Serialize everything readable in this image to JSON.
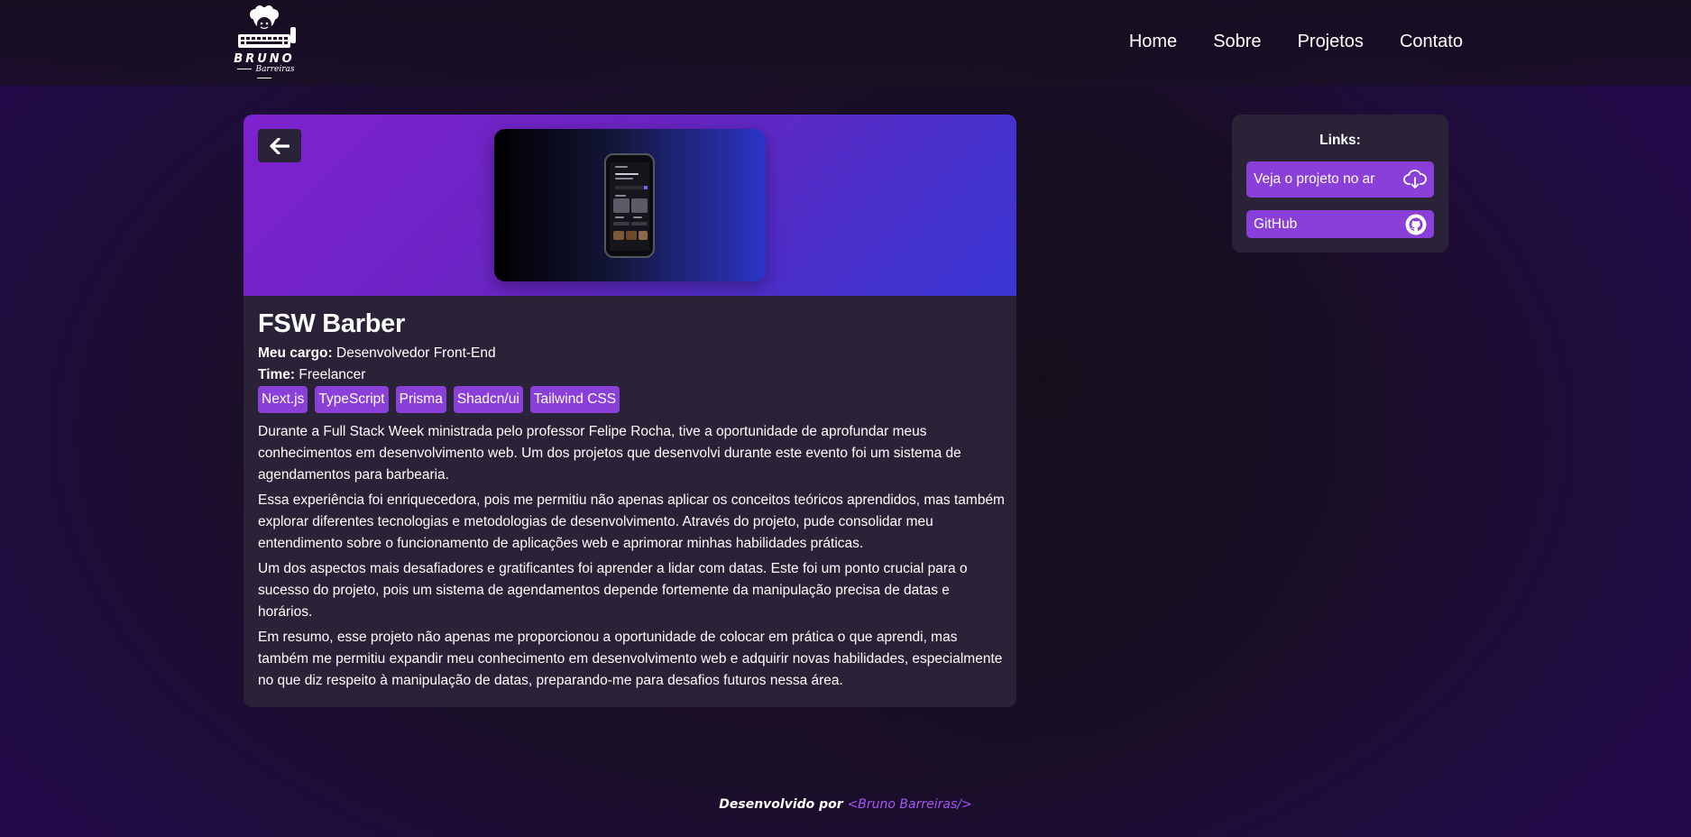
{
  "header": {
    "logo_title": "BRUNO",
    "logo_subtitle": "Barreiras",
    "nav": [
      "Home",
      "Sobre",
      "Projetos",
      "Contato"
    ]
  },
  "project": {
    "back_icon": "arrow-left-icon",
    "title": "FSW Barber",
    "role_label": "Meu cargo:",
    "role_value": "Desenvolvedor Front-End",
    "team_label": "Time:",
    "team_value": "Freelancer",
    "tags": [
      "Next.js",
      "TypeScript",
      "Prisma",
      "Shadcn/ui",
      "Tailwind CSS"
    ],
    "paragraphs": [
      "Durante a Full Stack Week ministrada pelo professor Felipe Rocha, tive a oportunidade de aprofundar meus conhecimentos em desenvolvimento web. Um dos projetos que desenvolvi durante este evento foi um sistema de agendamentos para barbearia.",
      "Essa experiência foi enriquecedora, pois me permitiu não apenas aplicar os conceitos teóricos aprendidos, mas também explorar diferentes tecnologias e metodologias de desenvolvimento. Através do projeto, pude consolidar meu entendimento sobre o funcionamento de aplicações web e aprimorar minhas habilidades práticas.",
      "Um dos aspectos mais desafiadores e gratificantes foi aprender a lidar com datas. Este foi um ponto crucial para o sucesso do projeto, pois um sistema de agendamentos depende fortemente da manipulação precisa de datas e horários.",
      "Em resumo, esse projeto não apenas me proporcionou a oportunidade de colocar em prática o que aprendi, mas também me permitiu expandir meu conhecimento em desenvolvimento web e adquirir novas habilidades, especialmente no que diz respeito à manipulação de datas, preparando-me para desafios futuros nessa área."
    ]
  },
  "links": {
    "title": "Links:",
    "live_label": "Veja o projeto no ar",
    "live_icon": "cloud-download-icon",
    "github_label": "GitHub",
    "github_icon": "github-icon"
  },
  "footer": {
    "prefix": "Desenvolvido por ",
    "name": "<Bruno Barreiras/>"
  },
  "colors": {
    "accent": "#8b3fd9",
    "card": "#2a2236",
    "footer_accent": "#a855f7"
  }
}
